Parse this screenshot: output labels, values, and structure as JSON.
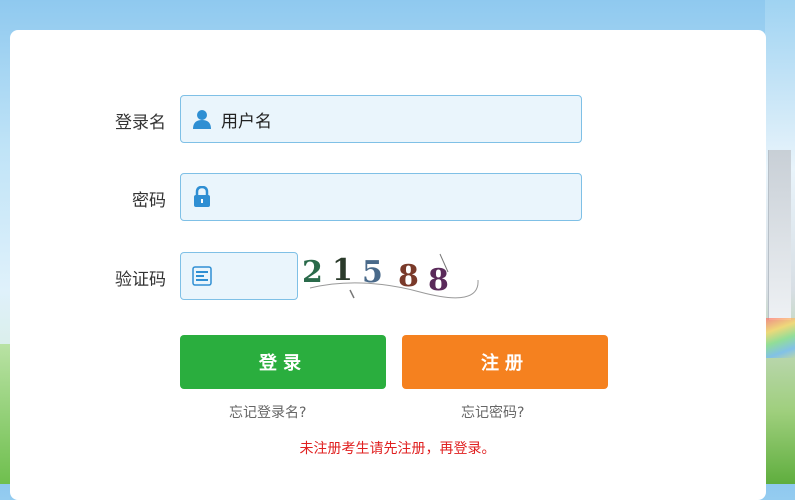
{
  "form": {
    "username_label": "登录名",
    "username_value": "用户名",
    "password_label": "密码",
    "password_value": "",
    "captcha_label": "验证码",
    "captcha_value": "",
    "captcha_text": "21588"
  },
  "buttons": {
    "login_label": "登录",
    "register_label": "注册"
  },
  "links": {
    "forgot_username": "忘记登录名?",
    "forgot_password": "忘记密码?"
  },
  "notice": "未注册考生请先注册，再登录。",
  "icons": {
    "username": "user-icon",
    "password": "lock-icon",
    "captcha": "captcha-icon"
  },
  "colors": {
    "login_button": "#2aae3e",
    "register_button": "#f5811f",
    "notice_text": "#e02020",
    "input_border": "#7fc0e6"
  }
}
